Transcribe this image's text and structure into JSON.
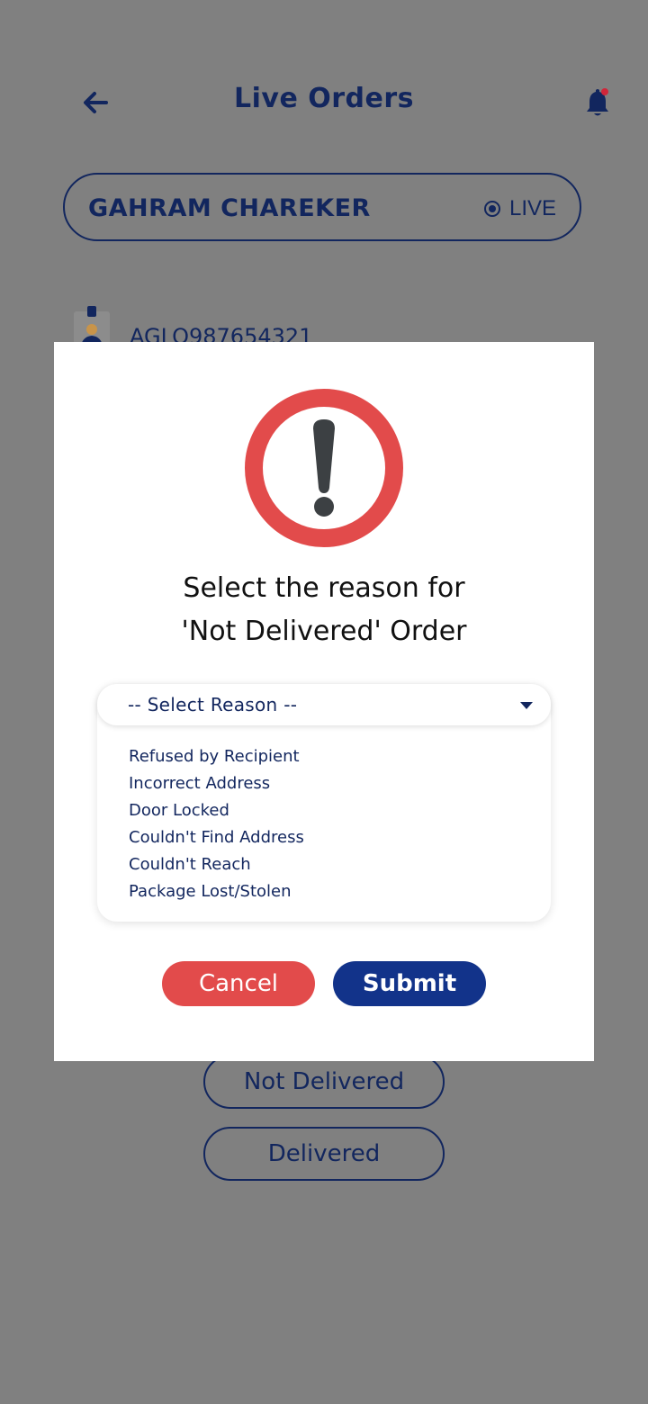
{
  "header": {
    "title": "Live Orders",
    "back_icon": "arrow-left-icon",
    "bell_icon": "bell-icon"
  },
  "driver": {
    "name": "GAHRAM CHAREKER",
    "status": "LIVE"
  },
  "order": {
    "id": "AGLO987654321",
    "icon": "courier-icon"
  },
  "actions": {
    "not_delivered": "Not Delivered",
    "delivered": "Delivered"
  },
  "modal": {
    "title_line1": "Select the reason for",
    "title_line2": "'Not Delivered' Order",
    "select_placeholder": "-- Select Reason --",
    "reasons": [
      "Refused by Recipient",
      "Incorrect Address",
      "Door Locked",
      "Couldn't Find Address",
      "Couldn't Reach",
      "Package Lost/Stolen"
    ],
    "cancel": "Cancel",
    "submit": "Submit"
  },
  "colors": {
    "overlay": "#808080",
    "primary": "#12265e",
    "danger": "#e24b4b",
    "submit": "#12338a"
  }
}
